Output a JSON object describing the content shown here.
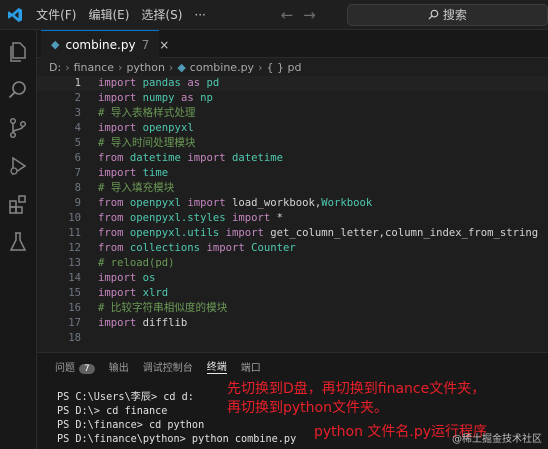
{
  "titlebar": {
    "menu": [
      "文件(F)",
      "编辑(E)",
      "选择(S)",
      "···"
    ],
    "nav_back": "←",
    "nav_forward": "→",
    "search_placeholder": "搜索"
  },
  "tab": {
    "filename": "combine.py",
    "modified_count": "7",
    "close": "×"
  },
  "breadcrumb": [
    "D:",
    "finance",
    "python",
    "combine.py",
    "{ } pd"
  ],
  "editor": {
    "active_line": 1,
    "lines": [
      {
        "n": "1",
        "tokens": [
          [
            "kw",
            "import"
          ],
          [
            "txt",
            " "
          ],
          [
            "mod",
            "pandas"
          ],
          [
            "txt",
            " "
          ],
          [
            "kw",
            "as"
          ],
          [
            "txt",
            " "
          ],
          [
            "mod",
            "pd"
          ]
        ]
      },
      {
        "n": "2",
        "tokens": [
          [
            "kw",
            "import"
          ],
          [
            "txt",
            " "
          ],
          [
            "mod",
            "numpy"
          ],
          [
            "txt",
            " "
          ],
          [
            "kw",
            "as"
          ],
          [
            "txt",
            " "
          ],
          [
            "mod",
            "np"
          ]
        ]
      },
      {
        "n": "3",
        "tokens": [
          [
            "cm",
            "# 导入表格样式处理"
          ]
        ]
      },
      {
        "n": "4",
        "tokens": [
          [
            "kw",
            "import"
          ],
          [
            "txt",
            " "
          ],
          [
            "mod",
            "openpyxl"
          ]
        ]
      },
      {
        "n": "5",
        "tokens": [
          [
            "cm",
            "# 导入时间处理模块"
          ]
        ]
      },
      {
        "n": "6",
        "tokens": [
          [
            "kw",
            "from"
          ],
          [
            "txt",
            " "
          ],
          [
            "mod",
            "datetime"
          ],
          [
            "txt",
            " "
          ],
          [
            "kw",
            "import"
          ],
          [
            "txt",
            " "
          ],
          [
            "mod",
            "datetime"
          ]
        ]
      },
      {
        "n": "7",
        "tokens": [
          [
            "kw",
            "import"
          ],
          [
            "txt",
            " "
          ],
          [
            "mod",
            "time"
          ]
        ]
      },
      {
        "n": "8",
        "tokens": [
          [
            "cm",
            "# 导入填充模块"
          ]
        ]
      },
      {
        "n": "9",
        "tokens": [
          [
            "kw",
            "from"
          ],
          [
            "txt",
            " "
          ],
          [
            "mod",
            "openpyxl"
          ],
          [
            "txt",
            " "
          ],
          [
            "kw",
            "import"
          ],
          [
            "txt",
            " load_workbook,"
          ],
          [
            "mod",
            "Workbook"
          ]
        ]
      },
      {
        "n": "10",
        "tokens": [
          [
            "kw",
            "from"
          ],
          [
            "txt",
            " "
          ],
          [
            "mod",
            "openpyxl.styles"
          ],
          [
            "txt",
            " "
          ],
          [
            "kw",
            "import"
          ],
          [
            "txt",
            " *"
          ]
        ]
      },
      {
        "n": "11",
        "tokens": [
          [
            "kw",
            "from"
          ],
          [
            "txt",
            " "
          ],
          [
            "mod",
            "openpyxl.utils"
          ],
          [
            "txt",
            " "
          ],
          [
            "kw",
            "import"
          ],
          [
            "txt",
            " get_column_letter,column_index_from_string"
          ]
        ]
      },
      {
        "n": "12",
        "tokens": [
          [
            "kw",
            "from"
          ],
          [
            "txt",
            " "
          ],
          [
            "mod",
            "collections"
          ],
          [
            "txt",
            " "
          ],
          [
            "kw",
            "import"
          ],
          [
            "txt",
            " "
          ],
          [
            "mod",
            "Counter"
          ]
        ]
      },
      {
        "n": "13",
        "tokens": [
          [
            "cm",
            "# reload(pd)"
          ]
        ]
      },
      {
        "n": "14",
        "tokens": [
          [
            "kw",
            "import"
          ],
          [
            "txt",
            " "
          ],
          [
            "mod",
            "os"
          ]
        ]
      },
      {
        "n": "15",
        "tokens": [
          [
            "kw",
            "import"
          ],
          [
            "txt",
            " "
          ],
          [
            "mod",
            "xlrd"
          ]
        ]
      },
      {
        "n": "16",
        "tokens": [
          [
            "cm",
            "# 比较字符串相似度的模块"
          ]
        ]
      },
      {
        "n": "17",
        "tokens": [
          [
            "kw",
            "import"
          ],
          [
            "txt",
            " difflib"
          ]
        ]
      },
      {
        "n": "18",
        "tokens": []
      }
    ]
  },
  "panel": {
    "tabs": [
      "问题",
      "输出",
      "调试控制台",
      "终端",
      "端口"
    ],
    "problems_count": "7",
    "active_tab": "终端",
    "terminal_lines": [
      "PS C:\\Users\\李辰> cd d:",
      "PS D:\\> cd finance",
      "PS D:\\finance> cd python",
      "PS D:\\finance\\python> python combine.py"
    ]
  },
  "annotations": [
    "先切换到D盘，再切换到finance文件夹，",
    "再切换到python文件夹。",
    "python   文件名.py运行程序"
  ],
  "watermark": "@稀土掘金技术社区",
  "colors": {
    "accent": "#0078d4",
    "keyword": "#c586c0",
    "module": "#4ec9b0",
    "comment": "#6a9955",
    "annotation": "#e8202a"
  }
}
